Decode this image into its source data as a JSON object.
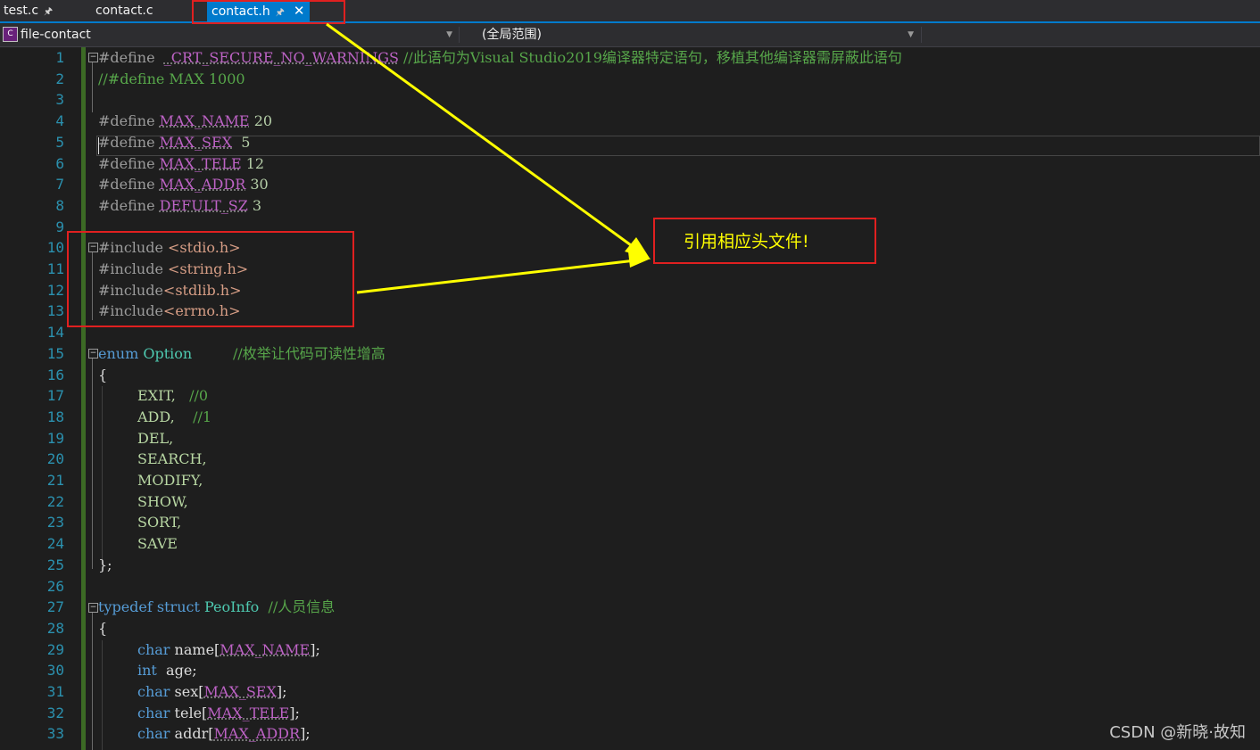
{
  "tabs": [
    {
      "label": "test.c",
      "pinned": true,
      "active": false
    },
    {
      "label": "contact.c",
      "pinned": false,
      "active": false
    },
    {
      "label": "contact.h",
      "pinned": true,
      "active": true
    }
  ],
  "navbar": {
    "project": "file-contact",
    "scope": "(全局范围)"
  },
  "line_numbers": [
    "1",
    "2",
    "3",
    "4",
    "5",
    "6",
    "7",
    "8",
    "9",
    "10",
    "11",
    "12",
    "13",
    "14",
    "15",
    "16",
    "17",
    "18",
    "19",
    "20",
    "21",
    "22",
    "23",
    "24",
    "25",
    "26",
    "27",
    "28",
    "29",
    "30",
    "31",
    "32",
    "33"
  ],
  "code": {
    "l1": {
      "pp": "#define",
      "macro": "_CRT_SECURE_NO_WARNINGS",
      "comment": "//此语句为Visual Studio2019编译器特定语句，移植其他编译器需屏蔽此语句"
    },
    "l2": {
      "comment": "//#define MAX 1000"
    },
    "l4": {
      "pp": "#define",
      "macro": "MAX_NAME",
      "value": "20"
    },
    "l5": {
      "pp": "#define",
      "macro": "MAX_SEX",
      "value": "5"
    },
    "l6": {
      "pp": "#define",
      "macro": "MAX_TELE",
      "value": "12"
    },
    "l7": {
      "pp": "#define",
      "macro": "MAX_ADDR",
      "value": "30"
    },
    "l8": {
      "pp": "#define",
      "macro": "DEFULT_SZ",
      "value": "3"
    },
    "l10": {
      "pp": "#include",
      "header": "<stdio.h>"
    },
    "l11": {
      "pp": "#include",
      "header": "<string.h>"
    },
    "l12": {
      "pp": "#include",
      "header": "<stdlib.h>"
    },
    "l13": {
      "pp": "#include",
      "header": "<errno.h>"
    },
    "l15": {
      "kw": "enum",
      "type": "Option",
      "comment": "//枚举让代码可读性增高"
    },
    "l16": "{",
    "l17": {
      "value": "EXIT,",
      "comment": "//0"
    },
    "l18": {
      "value": "ADD,",
      "comment": "//1"
    },
    "l19": "DEL,",
    "l20": "SEARCH,",
    "l21": "MODIFY,",
    "l22": "SHOW,",
    "l23": "SORT,",
    "l24": "SAVE",
    "l25": "};",
    "l27": {
      "kw1": "typedef",
      "kw2": "struct",
      "type": "PeoInfo",
      "comment": "//人员信息"
    },
    "l28": "{",
    "l29": {
      "kw": "char",
      "name": "name",
      "macro": "MAX_NAME"
    },
    "l30": {
      "kw": "int",
      "name": "age;"
    },
    "l31": {
      "kw": "char",
      "name": "sex",
      "macro": "MAX_SEX"
    },
    "l32": {
      "kw": "char",
      "name": "tele",
      "macro": "MAX_TELE"
    },
    "l33": {
      "kw": "char",
      "name": "addr",
      "macro": "MAX_ADDR"
    }
  },
  "annotation": {
    "callout_text": "引用相应头文件!",
    "box_color": "#e02020",
    "arrow_color": "#ffff00"
  },
  "watermark": "CSDN @新晓·故知",
  "colors": {
    "accent": "#007acc",
    "line_number": "#2b91af",
    "keyword": "#569cd6",
    "type": "#4ec9b0",
    "comment": "#57a64a",
    "macro": "#bd63c5",
    "string": "#d69d85",
    "number": "#b5cea8"
  }
}
